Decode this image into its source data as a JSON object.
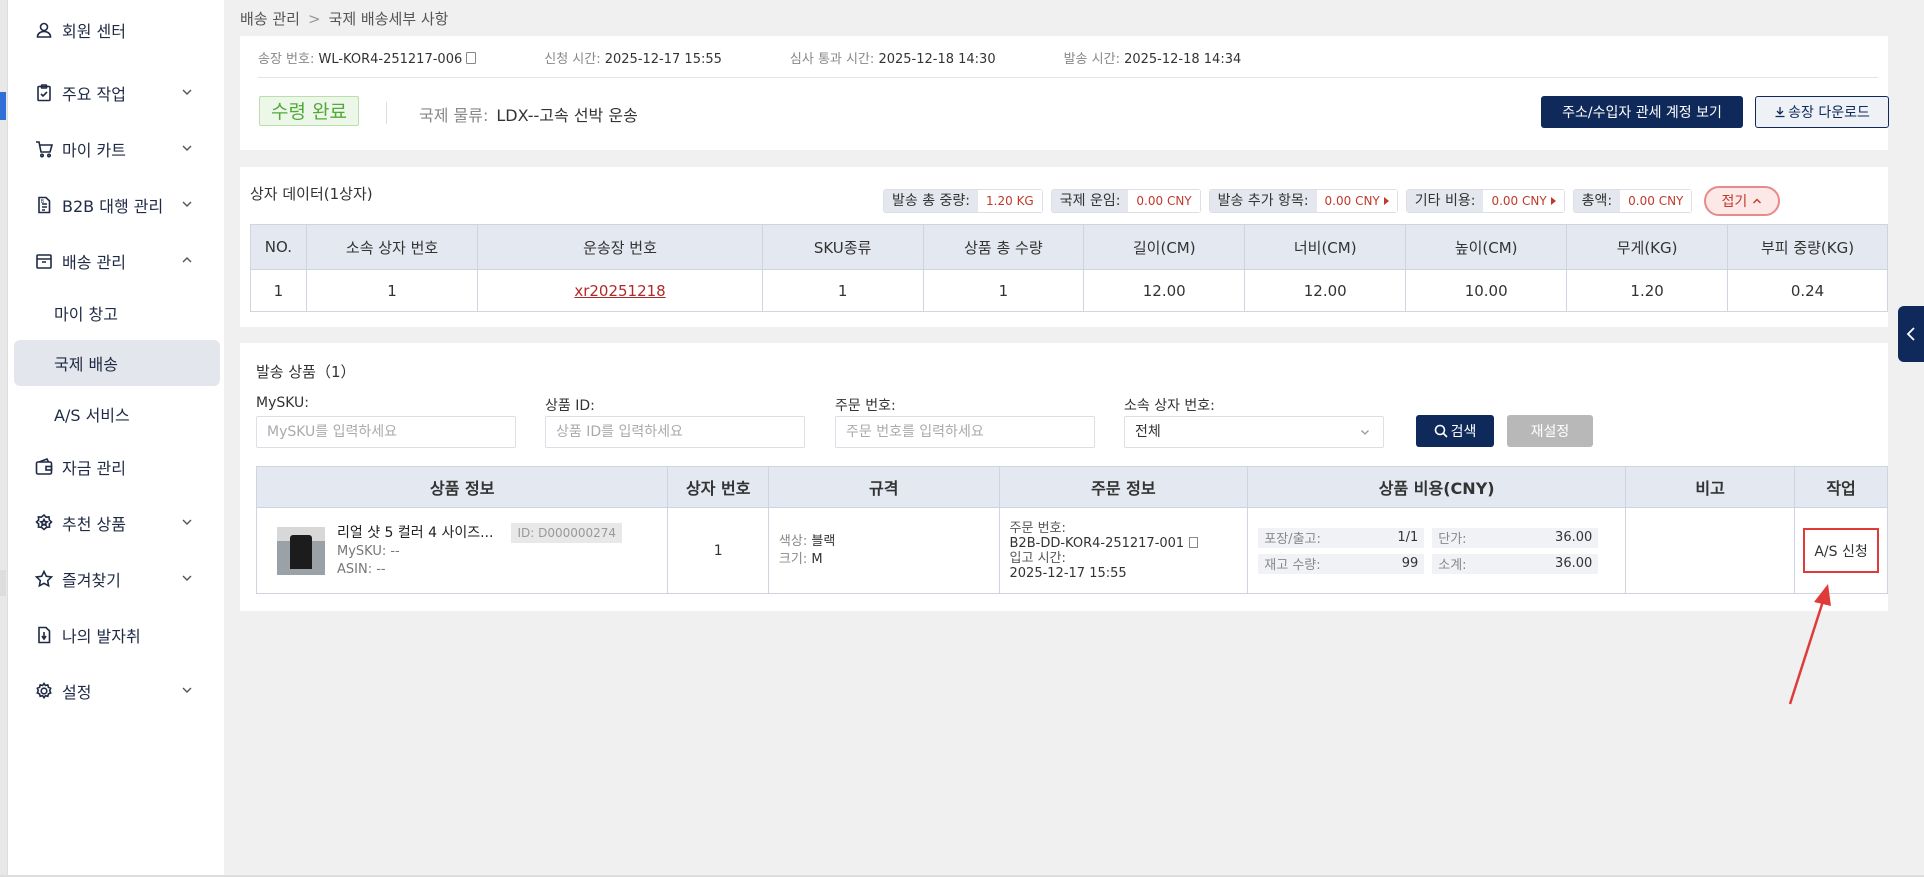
{
  "sidebar": {
    "items": [
      {
        "label": "회원 센터",
        "icon": "user-icon",
        "has_chevron": false
      },
      {
        "label": "주요 작업",
        "icon": "clipboard-icon",
        "has_chevron": true
      },
      {
        "label": "마이 카트",
        "icon": "cart-icon",
        "has_chevron": true
      },
      {
        "label": "B2B 대행 관리",
        "icon": "document-icon",
        "has_chevron": true
      },
      {
        "label": "배송 관리",
        "icon": "box-icon",
        "has_chevron": true,
        "expanded": true
      },
      {
        "label": "자금 관리",
        "icon": "wallet-icon",
        "has_chevron": false
      },
      {
        "label": "추천 상품",
        "icon": "badge-icon",
        "has_chevron": true
      },
      {
        "label": "즐겨찾기",
        "icon": "star-icon",
        "has_chevron": true
      },
      {
        "label": "나의 발자취",
        "icon": "history-icon",
        "has_chevron": false
      },
      {
        "label": "설정",
        "icon": "gear-icon",
        "has_chevron": true
      }
    ],
    "sub_items": [
      {
        "label": "마이 창고",
        "active": false
      },
      {
        "label": "국제 배송",
        "active": true
      },
      {
        "label": "A/S 서비스",
        "active": false
      }
    ]
  },
  "breadcrumb": {
    "parent": "배송 관리",
    "current": "국제 배송세부 사항"
  },
  "header": {
    "invoice_label": "송장 번호:",
    "invoice_value": "WL-KOR4-251217-006",
    "apply_label": "신청 시간:",
    "apply_value": "2025-12-17 15:55",
    "review_label": "심사 통과 시간:",
    "review_value": "2025-12-18 14:30",
    "ship_label": "발송 시간:",
    "ship_value": "2025-12-18 14:34",
    "status": "수령 완료",
    "logistics_label": "국제 물류:",
    "logistics_value": "LDX--고속 선박 운송",
    "btn_account": "주소/수입자 관세 계정 보기",
    "btn_download": "송장 다운로드"
  },
  "box_section": {
    "title": "상자 데이터(1상자)",
    "chips": [
      {
        "label": "발송 총 중량:",
        "value": "1.20 KG",
        "arrow": false
      },
      {
        "label": "국제 운임:",
        "value": "0.00 CNY",
        "arrow": false
      },
      {
        "label": "발송 추가 항목:",
        "value": "0.00 CNY",
        "arrow": true
      },
      {
        "label": "기타 비용:",
        "value": "0.00 CNY",
        "arrow": true
      },
      {
        "label": "총액:",
        "value": "0.00 CNY",
        "arrow": false
      }
    ],
    "fold_label": "접기",
    "columns": [
      "NO.",
      "소속 상자 번호",
      "운송장 번호",
      "SKU종류",
      "상품 총 수량",
      "길이(CM)",
      "너비(CM)",
      "높이(CM)",
      "무게(KG)",
      "부피 중량(KG)"
    ],
    "rows": [
      {
        "no": "1",
        "box_no": "1",
        "waybill": "xr20251218",
        "sku_types": "1",
        "qty": "1",
        "length": "12.00",
        "width": "12.00",
        "height": "10.00",
        "weight": "1.20",
        "vol_weight": "0.24"
      }
    ]
  },
  "goods_section": {
    "title": "발송 상품（1）",
    "filters": {
      "mysku_label": "MySKU:",
      "mysku_placeholder": "MySKU를 입력하세요",
      "productid_label": "상품 ID:",
      "productid_placeholder": "상품 ID를 입력하세요",
      "order_label": "주문 번호:",
      "order_placeholder": "주문 번호를 입력하세요",
      "box_label": "소속 상자 번호:",
      "box_value": "전체",
      "search_btn": "검색",
      "reset_btn": "재설정"
    },
    "columns": [
      "상품 정보",
      "상자 번호",
      "규격",
      "주문 정보",
      "상품 비용(CNY)",
      "비고",
      "작업"
    ],
    "rows": [
      {
        "name": "리얼 샷 5 컬러 4 사이즈...",
        "id_tag": "ID: D000000274",
        "mysku": "MySKU: --",
        "asin": "ASIN: --",
        "box_no": "1",
        "color_label": "색상:",
        "color_value": "블랙",
        "size_label": "크기:",
        "size_value": "M",
        "order_no_label": "주문 번호:",
        "order_no_value": "B2B-DD-KOR4-251217-001",
        "in_time_label": "입고 시간:",
        "in_time_value": "2025-12-17 15:55",
        "pack_label": "포장/출고:",
        "pack_value": "1/1",
        "unit_label": "단가:",
        "unit_value": "36.00",
        "stock_label": "재고 수량:",
        "stock_value": "99",
        "subtotal_label": "소계:",
        "subtotal_value": "36.00",
        "remark": "",
        "action": "A/S 신청"
      }
    ]
  },
  "colors": {
    "primary": "#0f2a5a",
    "success": "#52a93a",
    "danger": "#c0392b",
    "annotation": "#e03b3b"
  }
}
